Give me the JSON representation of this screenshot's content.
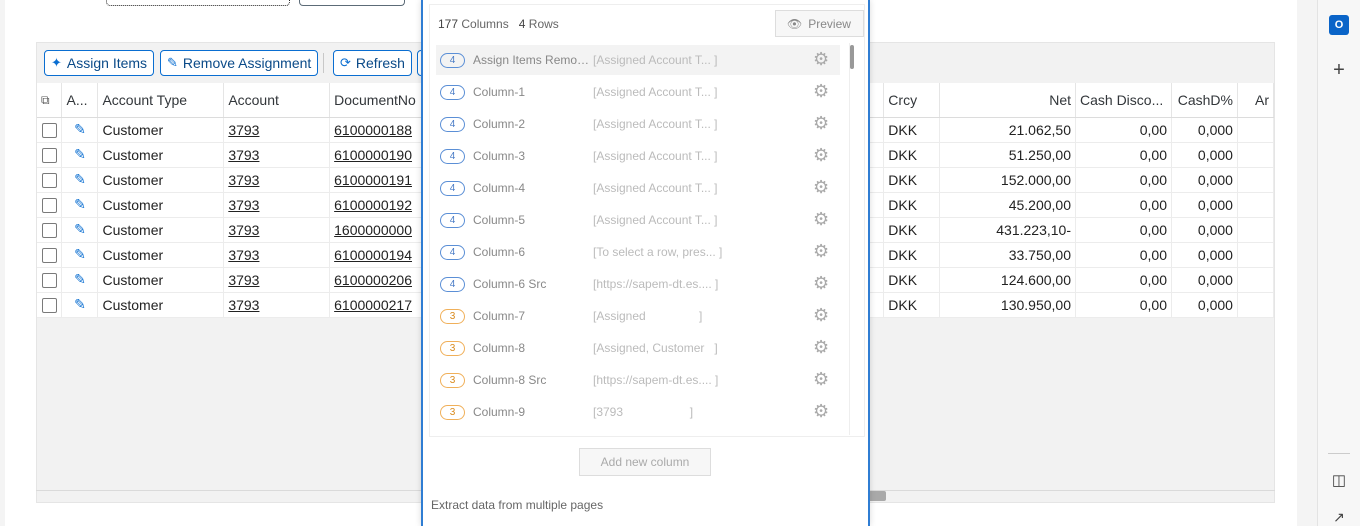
{
  "toolbar": {
    "assign_label": "Assign Items",
    "remove_label": "Remove Assignment",
    "refresh_label": "Refresh"
  },
  "table": {
    "headers": [
      "A...",
      "Account Type",
      "Account",
      "DocumentNo",
      "Crcy",
      "Net",
      "Cash Disco...",
      "CashD%",
      "Ar"
    ],
    "rows": [
      {
        "type": "Customer",
        "account": "3793",
        "doc": "6100000188",
        "crcy": "DKK",
        "net": "21.062,50",
        "disc": "0,00",
        "pct": "0,000"
      },
      {
        "type": "Customer",
        "account": "3793",
        "doc": "6100000190",
        "crcy": "DKK",
        "net": "51.250,00",
        "disc": "0,00",
        "pct": "0,000"
      },
      {
        "type": "Customer",
        "account": "3793",
        "doc": "6100000191",
        "crcy": "DKK",
        "net": "152.000,00",
        "disc": "0,00",
        "pct": "0,000"
      },
      {
        "type": "Customer",
        "account": "3793",
        "doc": "6100000192",
        "crcy": "DKK",
        "net": "45.200,00",
        "disc": "0,00",
        "pct": "0,000"
      },
      {
        "type": "Customer",
        "account": "3793",
        "doc": "1600000000",
        "crcy": "DKK",
        "net": "431.223,10-",
        "disc": "0,00",
        "pct": "0,000"
      },
      {
        "type": "Customer",
        "account": "3793",
        "doc": "6100000194",
        "crcy": "DKK",
        "net": "33.750,00",
        "disc": "0,00",
        "pct": "0,000"
      },
      {
        "type": "Customer",
        "account": "3793",
        "doc": "6100000206",
        "crcy": "DKK",
        "net": "124.600,00",
        "disc": "0,00",
        "pct": "0,000"
      },
      {
        "type": "Customer",
        "account": "3793",
        "doc": "6100000217",
        "crcy": "DKK",
        "net": "130.950,00",
        "disc": "0,00",
        "pct": "0,000"
      }
    ]
  },
  "popup": {
    "columns_count": "177",
    "columns_label": "Columns",
    "rows_count": "4",
    "rows_label": "Rows",
    "preview_label": "Preview",
    "columns": [
      {
        "badge": "4",
        "name": "Assign Items Remov...",
        "value": "[Assigned Account T... ]"
      },
      {
        "badge": "4",
        "name": "Column-1",
        "value": "[Assigned Account T... ]"
      },
      {
        "badge": "4",
        "name": "Column-2",
        "value": "[Assigned Account T... ]"
      },
      {
        "badge": "4",
        "name": "Column-3",
        "value": "[Assigned Account T... ]"
      },
      {
        "badge": "4",
        "name": "Column-4",
        "value": "[Assigned Account T... ]"
      },
      {
        "badge": "4",
        "name": "Column-5",
        "value": "[Assigned Account T... ]"
      },
      {
        "badge": "4",
        "name": "Column-6",
        "value": "[To select a row, pres... ]"
      },
      {
        "badge": "4",
        "name": "Column-6 Src",
        "value": "[https://sapem-dt.es.... ]"
      },
      {
        "badge": "3",
        "name": "Column-7",
        "value": "[Assigned                ]"
      },
      {
        "badge": "3",
        "name": "Column-8",
        "value": "[Assigned, Customer   ]"
      },
      {
        "badge": "3",
        "name": "Column-8 Src",
        "value": "[https://sapem-dt.es.... ]"
      },
      {
        "badge": "3",
        "name": "Column-9",
        "value": "[3793                    ]"
      }
    ],
    "add_column_label": "Add new column",
    "extract_label": "Extract data from multiple pages"
  },
  "edge": {
    "outlook_icon": "O",
    "plus_icon": "+"
  }
}
